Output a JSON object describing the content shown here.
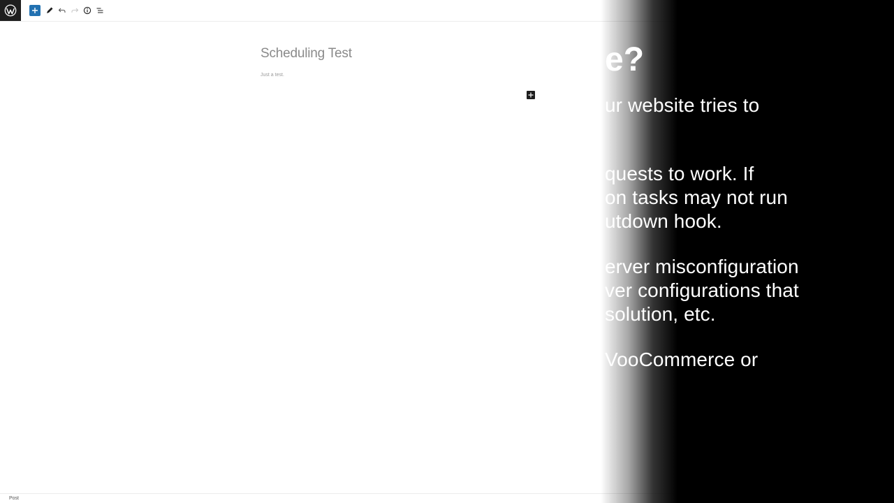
{
  "toolbar": {
    "logo_icon": "wordpress-logo-icon",
    "add_block_icon": "plus-icon",
    "tools_icon": "pencil-icon",
    "undo_icon": "undo-icon",
    "redo_icon": "redo-icon",
    "details_icon": "info-icon",
    "list_view_icon": "list-view-icon",
    "accent_color": "#2271b1"
  },
  "editor": {
    "post_title": "Scheduling Test",
    "paragraph": "Just a test.",
    "inserter_icon": "plus-icon"
  },
  "footer": {
    "breadcrumb": "Post"
  },
  "slide": {
    "heading": "e?",
    "lines": [
      "ur website tries to",
      "quests to work. If",
      "on tasks may not run",
      "utdown hook.",
      "erver misconfiguration",
      "ver configurations that",
      "solution, etc.",
      "VooCommerce or"
    ]
  }
}
